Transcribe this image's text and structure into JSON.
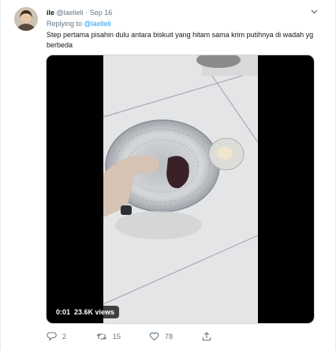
{
  "tweet": {
    "display_name": "ile",
    "handle": "@laelieli",
    "separator": "·",
    "date": "Sep 16",
    "replying_prefix": "Replying to",
    "replying_handle": "@laelieli",
    "text": "Step pertama pisahin dulu antara biskuit yang hitam sama krim putihnya di wadah yg berbeda"
  },
  "video": {
    "elapsed": "0:01",
    "views": "23.6K views"
  },
  "actions": {
    "reply_count": "2",
    "retweet_count": "15",
    "like_count": "78"
  },
  "icons": {
    "reply": "reply-icon",
    "retweet": "retweet-icon",
    "like": "heart-icon",
    "share": "share-icon",
    "caret": "chevron-down-icon"
  },
  "colors": {
    "link": "#1da1f2",
    "secondary_text": "#657786",
    "primary_text": "#14171a"
  }
}
